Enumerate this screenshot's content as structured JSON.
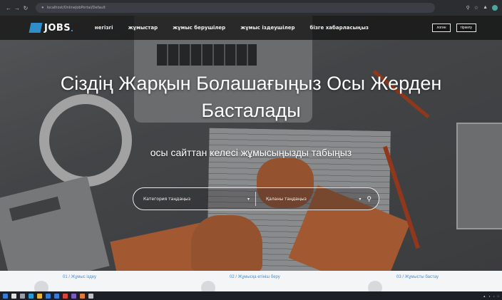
{
  "browser": {
    "url": "localhost/OnlineJobPortal/Default",
    "icons": [
      "back-icon",
      "forward-icon",
      "reload-icon",
      "lock-icon",
      "profile-icon"
    ]
  },
  "site": {
    "logo": "JOBS",
    "logo_dot": ".",
    "menu": [
      "негізгі",
      "жұмыстар",
      "жұмыс берушілер",
      "жұмыс іздеушілер",
      "бізге хабарласыңыз"
    ],
    "auth": [
      "логин",
      "тіркелу"
    ]
  },
  "hero": {
    "title_line1": "Сіздің Жарқын Болашағыңыз Осы Жерден",
    "title_line2": "Басталады",
    "subtitle": "осы сайттан келесі жұмысыңызды табыңыз"
  },
  "search": {
    "category_placeholder": "Категория таңдаңыз",
    "city_placeholder": "Қаланы таңдаңыз",
    "icon": "search-icon"
  },
  "steps": [
    {
      "label": "01 / Жұмыс іздеу"
    },
    {
      "label": "02 / Жұмысқа өтініш беру"
    },
    {
      "label": "03 / Жұмысты бастау"
    }
  ],
  "colors": {
    "accent": "#2f8ec9",
    "step_label": "#4a8fd6",
    "nav_bg": "#0f0f0f",
    "taskbar": "#1c1f26"
  },
  "taskbar": {
    "icons": [
      "windows-icon",
      "search-icon",
      "taskview-icon",
      "edge-icon",
      "explorer-icon",
      "store-icon",
      "mail-icon",
      "chrome-icon",
      "app-icon",
      "app-icon",
      "app-icon"
    ],
    "colors": [
      "#3a7bd5",
      "#e0e0e0",
      "#9aa0a6",
      "#2b9bd6",
      "#e6b73a",
      "#3a7bd5",
      "#3a7bd5",
      "#d8453a",
      "#7a5cc0",
      "#e07a3a",
      "#c0c0c0"
    ]
  }
}
